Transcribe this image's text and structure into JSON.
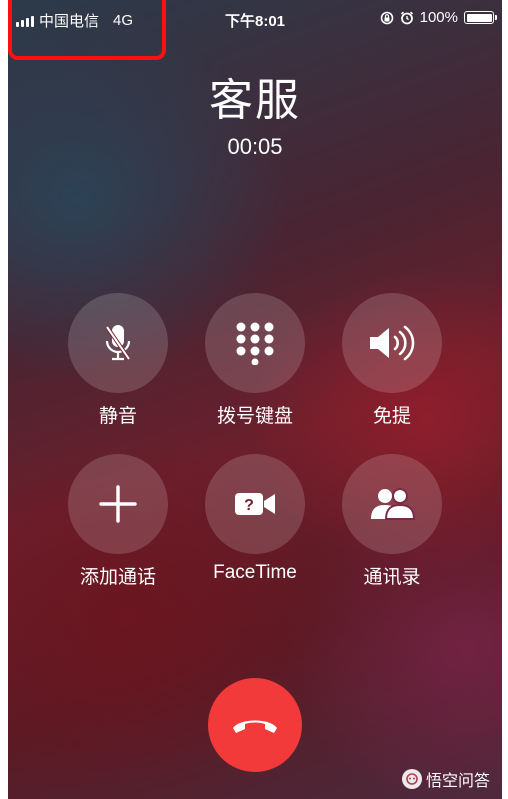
{
  "status_bar": {
    "carrier": "中国电信",
    "network": "4G",
    "time": "下午8:01",
    "battery": "100%",
    "battery_level": 1.0,
    "icons": [
      "signal-icon",
      "rotation-lock-icon",
      "alarm-icon",
      "battery-icon"
    ]
  },
  "call": {
    "caller_name": "客服",
    "duration": "00:05"
  },
  "controls": {
    "mute_label": "静音",
    "keypad_label": "拨号键盘",
    "speaker_label": "免提",
    "add_call_label": "添加通话",
    "facetime_label": "FaceTime",
    "contacts_label": "通讯录"
  },
  "watermark": {
    "text": "悟空问答"
  },
  "colors": {
    "end_call": "#f23a3a",
    "highlight": "#ff1010",
    "text": "#ffffff"
  }
}
